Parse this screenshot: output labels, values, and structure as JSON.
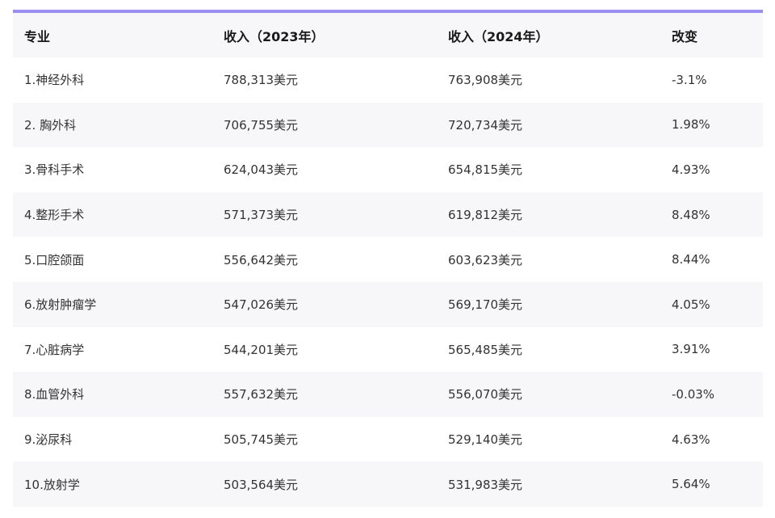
{
  "colors": {
    "accent_rule": "#9a8ff0",
    "row_alt": "#f7f7f9"
  },
  "table": {
    "headers": [
      "专业",
      "收入（2023年）",
      "收入（2024年）",
      "改变"
    ],
    "rows": [
      [
        "1.神经外科",
        "788,313美元",
        "763,908美元",
        "-3.1%"
      ],
      [
        "2. 胸外科",
        "706,755美元",
        "720,734美元",
        "1.98%"
      ],
      [
        "3.骨科手术",
        "624,043美元",
        "654,815美元",
        "4.93%"
      ],
      [
        "4.整形手术",
        "571,373美元",
        "619,812美元",
        "8.48%"
      ],
      [
        "5.口腔颌面",
        "556,642美元",
        "603,623美元",
        "8.44%"
      ],
      [
        "6.放射肿瘤学",
        "547,026美元",
        "569,170美元",
        "4.05%"
      ],
      [
        "7.心脏病学",
        "544,201美元",
        "565,485美元",
        "3.91%"
      ],
      [
        "8.血管外科",
        "557,632美元",
        "556,070美元",
        "-0.03%"
      ],
      [
        "9.泌尿科",
        "505,745美元",
        "529,140美元",
        "4.63%"
      ],
      [
        "10.放射学",
        "503,564美元",
        "531,983美元",
        "5.64%"
      ]
    ]
  }
}
